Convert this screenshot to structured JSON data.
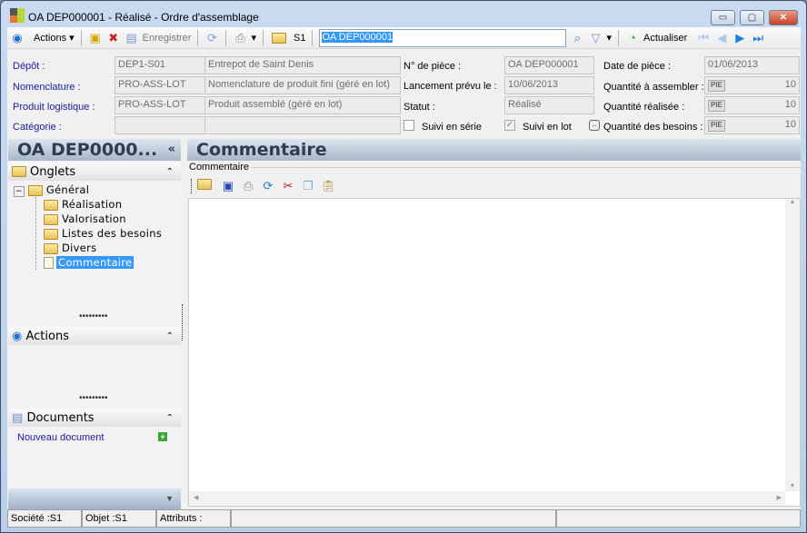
{
  "window": {
    "title": "OA DEP000001 - Réalisé -  Ordre d'assemblage",
    "minimize": "▭",
    "maximize": "▢",
    "close": "✕"
  },
  "toolbar": {
    "actions": "Actions",
    "save": "Enregistrer",
    "folder_label": "S1",
    "search_value": "OA DEP000001",
    "refresh": "Actualiser"
  },
  "form": {
    "left": [
      {
        "label": "Dépôt :",
        "code": "DEP1-S01",
        "desc": "Entrepot de  Saint  Denis"
      },
      {
        "label": "Nomenclature :",
        "code": "PRO-ASS-LOT",
        "desc": "Nomenclature de produit fini (géré en lot)"
      },
      {
        "label": "Produit logistique :",
        "code": "PRO-ASS-LOT",
        "desc": "Produit assemblé (géré en lot)"
      },
      {
        "label": "Catégorie :",
        "code": "",
        "desc": ""
      }
    ],
    "piece_label": "N° de pièce :",
    "piece": "OA DEP000001",
    "launch_label": "Lancement prévu le :",
    "launch": "10/06/2013",
    "status_label": "Statut :",
    "status": "Réalisé",
    "serial_label": "Suivi en série",
    "serial_checked": false,
    "lot_label": "Suivi en lot",
    "lot_checked": true,
    "date_label": "Date de pièce :",
    "date": "01/06/2013",
    "qty": [
      {
        "label": "Quantité à assembler :",
        "unit": "PIE",
        "value": "10"
      },
      {
        "label": "Quantité réalisée :",
        "unit": "PIE",
        "value": "10"
      },
      {
        "label": "Quantité des besoins :",
        "unit": "PIE",
        "value": "10"
      }
    ]
  },
  "sidebar": {
    "title": "OA DEP0000...",
    "collapse": "«",
    "tabs_header": "Onglets",
    "tree_root": "Général",
    "tree_items": [
      "Réalisation",
      "Valorisation",
      "Listes des besoins",
      "Divers",
      "Commentaire"
    ],
    "selected": "Commentaire",
    "actions_header": "Actions",
    "documents_header": "Documents",
    "new_document": "Nouveau document"
  },
  "main": {
    "title": "Commentaire",
    "group_label": "Commentaire"
  },
  "statusbar": {
    "company": "Société :S1",
    "object": "Objet :S1",
    "attributes": "Attributs :"
  }
}
